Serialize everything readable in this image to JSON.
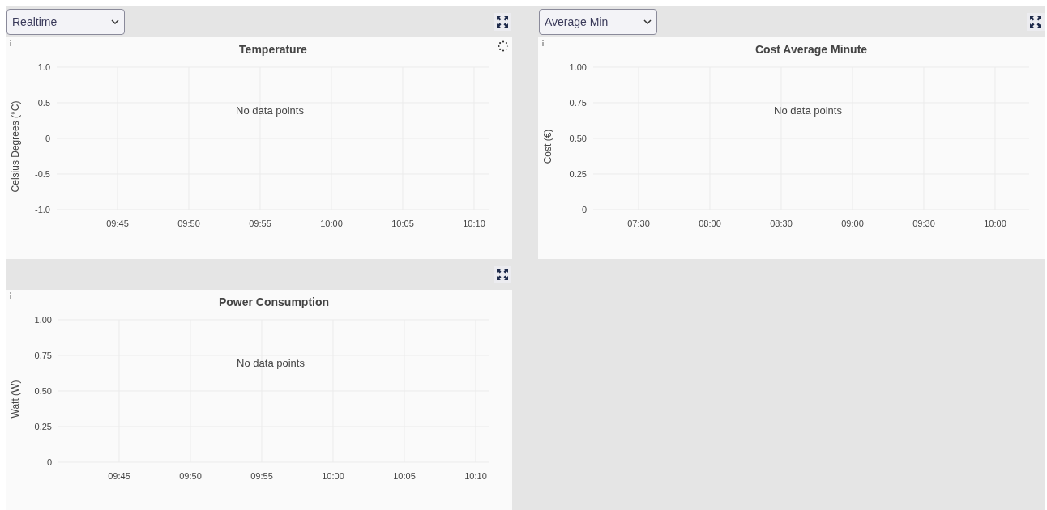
{
  "panels": [
    {
      "select": {
        "value": "Realtime"
      },
      "loading": true,
      "message": "No data points",
      "chart_data": {
        "type": "line",
        "grid": true,
        "title": "Temperature",
        "ylabel": "Celsius Degrees (°C)",
        "categories": [
          "09:45",
          "09:50",
          "09:55",
          "10:00",
          "10:05",
          "10:10"
        ],
        "ylim": [
          -1,
          1
        ],
        "yticks": [
          {
            "value": 1,
            "label": "1.0"
          },
          {
            "value": 0.5,
            "label": "0.5"
          },
          {
            "value": 0,
            "label": "0"
          },
          {
            "value": -0.5,
            "label": "-0.5"
          },
          {
            "value": -1,
            "label": "-1.0"
          }
        ]
      }
    },
    {
      "select": {
        "value": "Average Min"
      },
      "loading": false,
      "message": "No data points",
      "chart_data": {
        "type": "line",
        "grid": true,
        "title": "Cost Average Minute",
        "ylabel": "Cost (€)",
        "categories": [
          "07:30",
          "08:00",
          "08:30",
          "09:00",
          "09:30",
          "10:00"
        ],
        "ylim": [
          0,
          1
        ],
        "yticks": [
          {
            "value": 1,
            "label": "1.00"
          },
          {
            "value": 0.75,
            "label": "0.75"
          },
          {
            "value": 0.5,
            "label": "0.50"
          },
          {
            "value": 0.25,
            "label": "0.25"
          },
          {
            "value": 0,
            "label": "0"
          }
        ]
      }
    },
    {
      "loading": false,
      "message": "No data points",
      "chart_data": {
        "type": "line",
        "grid": true,
        "title": "Power Consumption",
        "ylabel": "Watt (W)",
        "categories": [
          "09:45",
          "09:50",
          "09:55",
          "10:00",
          "10:05",
          "10:10"
        ],
        "ylim": [
          0,
          1
        ],
        "yticks": [
          {
            "value": 1,
            "label": "1.00"
          },
          {
            "value": 0.75,
            "label": "0.75"
          },
          {
            "value": 0.5,
            "label": "0.50"
          },
          {
            "value": 0.25,
            "label": "0.25"
          },
          {
            "value": 0,
            "label": "0"
          }
        ]
      }
    }
  ]
}
